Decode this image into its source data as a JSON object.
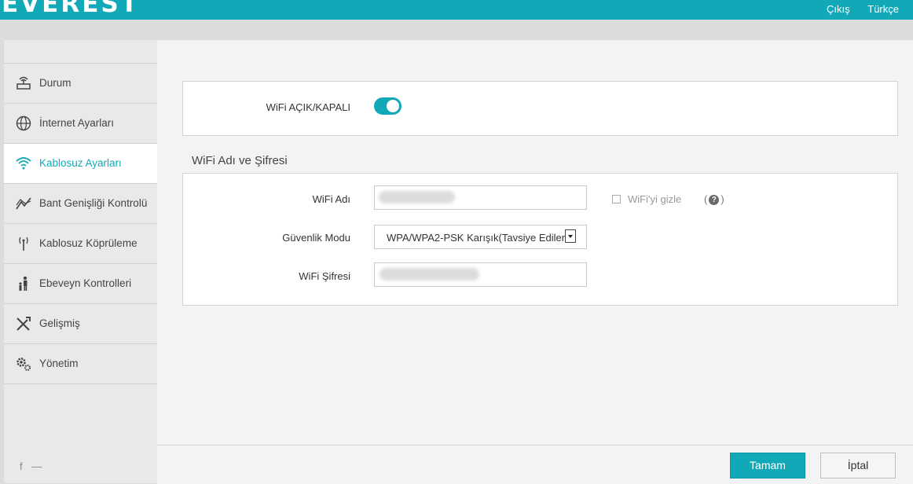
{
  "brand": {
    "logo_text": "EVEREST",
    "accent": "#11a9b8"
  },
  "header": {
    "logout": "Çıkış",
    "language": "Türkçe"
  },
  "sidebar": {
    "items": [
      {
        "label": "Durum",
        "icon": "router-icon",
        "active": false
      },
      {
        "label": "İnternet Ayarları",
        "icon": "globe-icon",
        "active": false
      },
      {
        "label": "Kablosuz Ayarları",
        "icon": "wifi-icon",
        "active": true
      },
      {
        "label": "Bant Genişliği Kontrolü",
        "icon": "bandwidth-chart-icon",
        "active": false
      },
      {
        "label": "Kablosuz Köprüleme",
        "icon": "antenna-icon",
        "active": false
      },
      {
        "label": "Ebeveyn Kontrolleri",
        "icon": "parent-child-icon",
        "active": false
      },
      {
        "label": "Gelişmiş",
        "icon": "tools-icon",
        "active": false
      },
      {
        "label": "Yönetim",
        "icon": "gears-icon",
        "active": false
      }
    ],
    "social": {
      "facebook": "f",
      "other": "—"
    }
  },
  "wifi_toggle": {
    "label": "WiFi AÇIK/KAPALI",
    "on": true
  },
  "wifi_section": {
    "title": "WiFi Adı ve Şifresi",
    "name_label": "WiFi Adı",
    "hide_label": "WiFi'yi gizle",
    "hide_checked": false,
    "help_open": "(",
    "help_symbol": "?",
    "help_close": ")",
    "security_label": "Güvenlik Modu",
    "security_value": "WPA/WPA2-PSK Karışık(Tavsiye Edilen)",
    "password_label": "WiFi Şifresi"
  },
  "buttons": {
    "ok": "Tamam",
    "cancel": "İptal"
  }
}
